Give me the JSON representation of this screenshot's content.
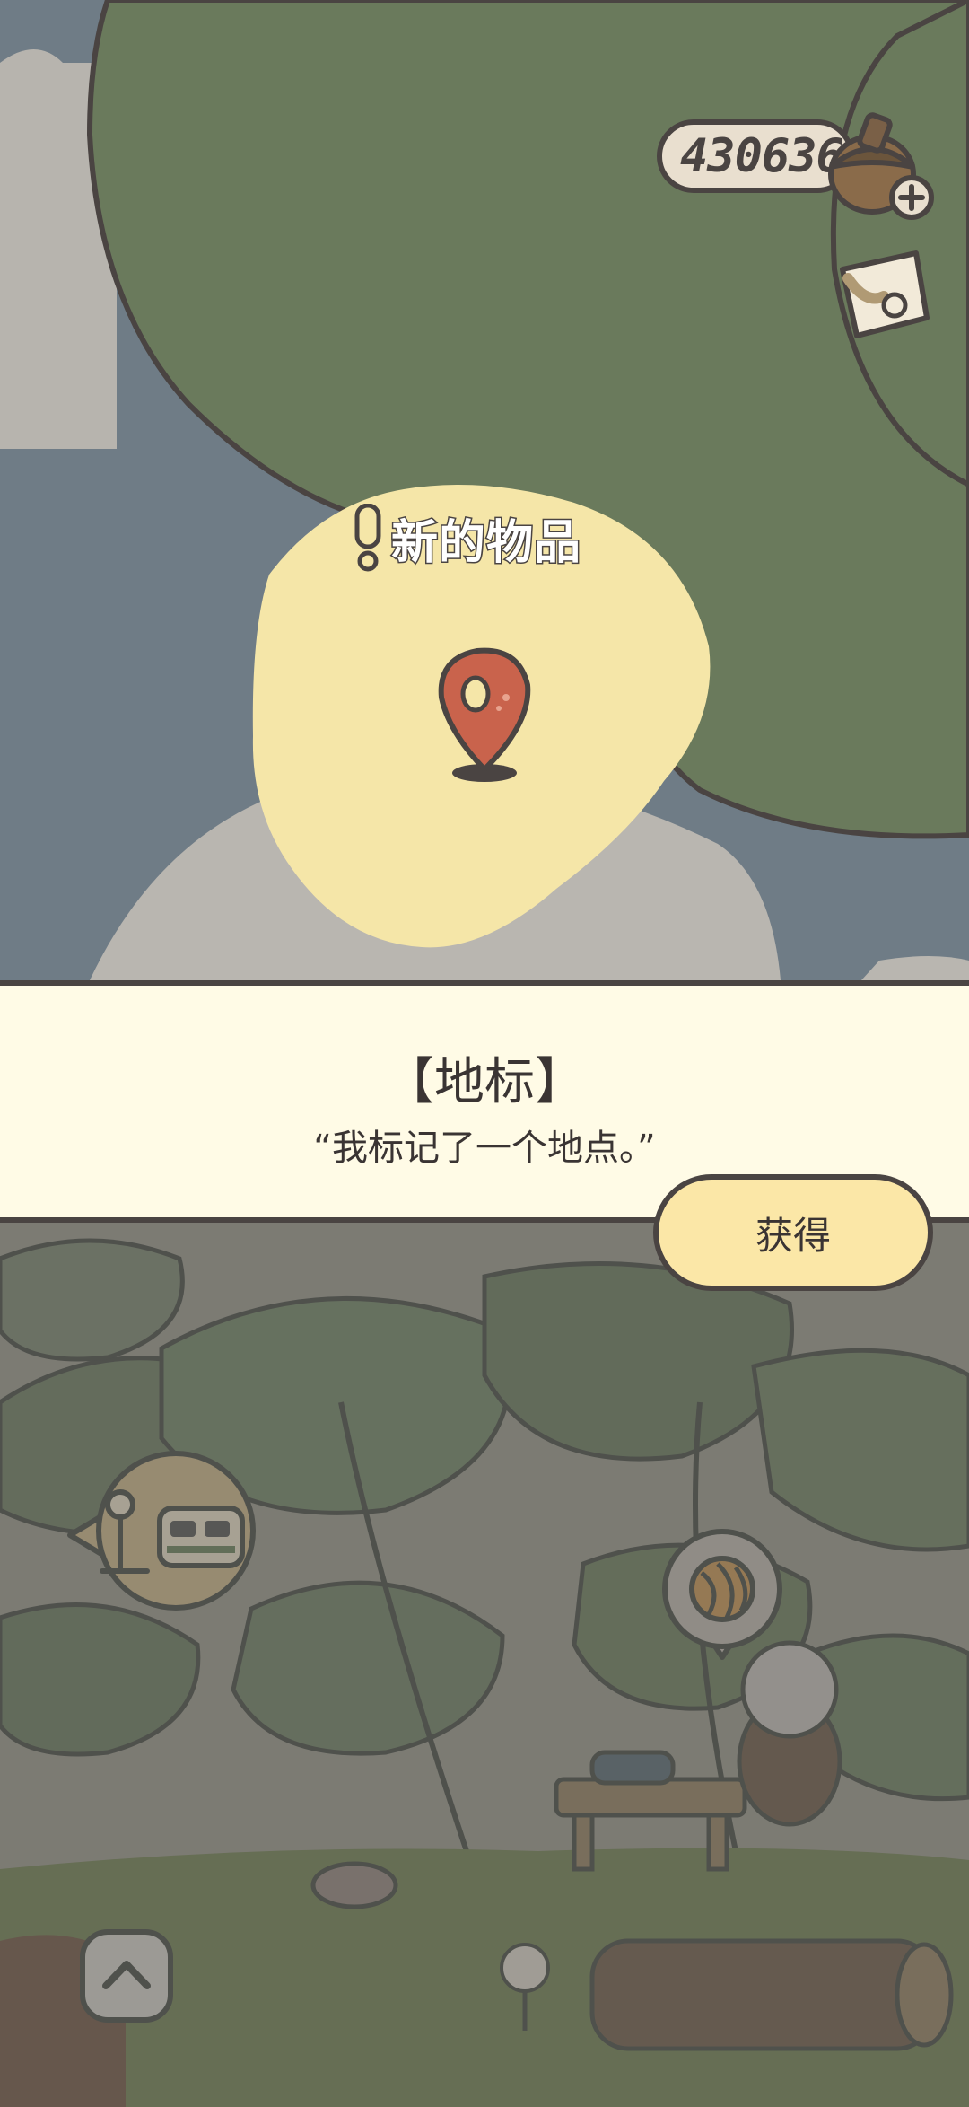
{
  "hud": {
    "currency_value": "430636",
    "currency_icon": "acorn-icon",
    "add_icon": "plus-icon",
    "letter_icon": "letter-icon"
  },
  "map": {
    "new_item_label": "新的物品",
    "alert_icon": "exclamation-icon",
    "pin_icon": "location-pin-icon"
  },
  "item_panel": {
    "title": "【地标】",
    "quote": "“我标记了一个地点。”",
    "get_button_label": "获得"
  },
  "scene": {
    "bus_stop_icon": "bus-stop-icon",
    "yarn_icon": "yarn-icon",
    "up_icon": "chevron-up-icon"
  },
  "colors": {
    "outline": "#4a4442",
    "water": "#6f7c86",
    "land_green": "#6a7a5c",
    "highlight": "#f5e6a8",
    "panel_bg": "#fffbe6",
    "button_bg": "#fbe7a7"
  }
}
